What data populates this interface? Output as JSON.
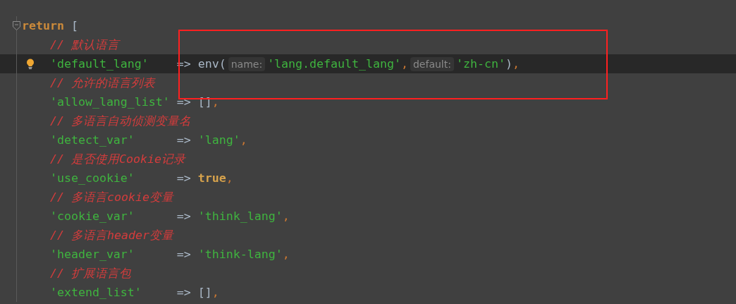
{
  "editor": {
    "annotation_box": true,
    "lines": [
      {
        "kind": "statement",
        "fold": true,
        "current": false,
        "bulb": false,
        "tokens": [
          {
            "kind": "keyword",
            "text": "return"
          },
          {
            "kind": "plain",
            "text": " ["
          }
        ]
      },
      {
        "kind": "comment",
        "current": false,
        "bulb": false,
        "text": "// 默认语言"
      },
      {
        "kind": "entry",
        "current": true,
        "bulb": true,
        "key": "'default_lang'",
        "arrow": "=>",
        "tokens": [
          {
            "kind": "plain",
            "text": "env("
          },
          {
            "kind": "hint",
            "text": "name:"
          },
          {
            "kind": "string",
            "text": "'lang.default_lang'"
          },
          {
            "kind": "punct",
            "text": ","
          },
          {
            "kind": "hint",
            "text": "default:"
          },
          {
            "kind": "string",
            "text": "'zh-cn'"
          },
          {
            "kind": "plain",
            "text": ")"
          },
          {
            "kind": "punct",
            "text": ","
          }
        ]
      },
      {
        "kind": "comment",
        "current": false,
        "bulb": false,
        "text": "// 允许的语言列表"
      },
      {
        "kind": "entry",
        "current": false,
        "bulb": false,
        "key": "'allow_lang_list'",
        "arrow": "=>",
        "tokens": [
          {
            "kind": "plain",
            "text": "[]"
          },
          {
            "kind": "punct",
            "text": ","
          }
        ]
      },
      {
        "kind": "comment",
        "current": false,
        "bulb": false,
        "text": "// 多语言自动侦测变量名"
      },
      {
        "kind": "entry",
        "current": false,
        "bulb": false,
        "key": "'detect_var'",
        "arrow": "=>",
        "tokens": [
          {
            "kind": "string",
            "text": "'lang'"
          },
          {
            "kind": "punct",
            "text": ","
          }
        ]
      },
      {
        "kind": "comment",
        "current": false,
        "bulb": false,
        "text": "// 是否使用Cookie记录"
      },
      {
        "kind": "entry",
        "current": false,
        "bulb": false,
        "key": "'use_cookie'",
        "arrow": "=>",
        "tokens": [
          {
            "kind": "boolean",
            "text": "true"
          },
          {
            "kind": "punct",
            "text": ","
          }
        ]
      },
      {
        "kind": "comment",
        "current": false,
        "bulb": false,
        "text": "// 多语言cookie变量"
      },
      {
        "kind": "entry",
        "current": false,
        "bulb": false,
        "key": "'cookie_var'",
        "arrow": "=>",
        "tokens": [
          {
            "kind": "string",
            "text": "'think_lang'"
          },
          {
            "kind": "punct",
            "text": ","
          }
        ]
      },
      {
        "kind": "comment",
        "current": false,
        "bulb": false,
        "text": "// 多语言header变量"
      },
      {
        "kind": "entry",
        "current": false,
        "bulb": false,
        "key": "'header_var'",
        "arrow": "=>",
        "tokens": [
          {
            "kind": "string",
            "text": "'think-lang'"
          },
          {
            "kind": "punct",
            "text": ","
          }
        ]
      },
      {
        "kind": "comment",
        "current": false,
        "bulb": false,
        "text": "// 扩展语言包"
      },
      {
        "kind": "entry",
        "current": false,
        "bulb": false,
        "key": "'extend_list'",
        "arrow": "=>",
        "tokens": [
          {
            "kind": "plain",
            "text": "[]"
          },
          {
            "kind": "punct",
            "text": ","
          }
        ]
      }
    ]
  }
}
